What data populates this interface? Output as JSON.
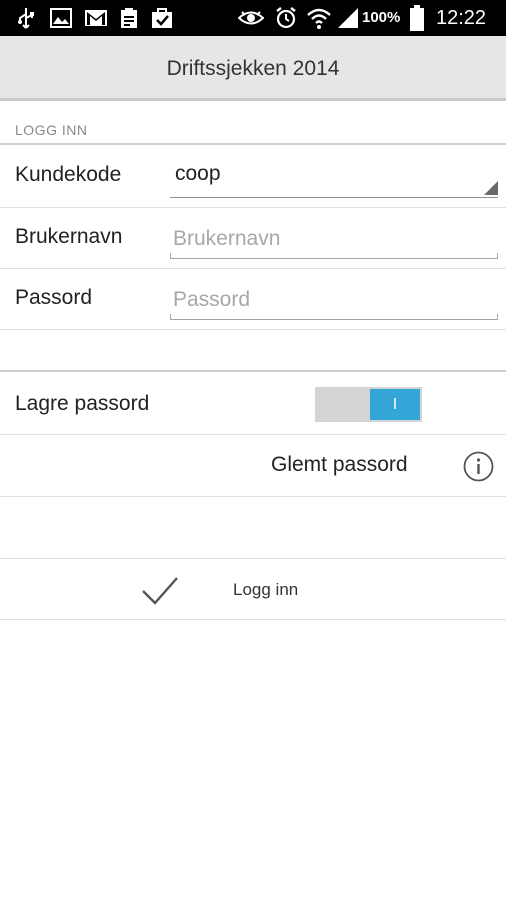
{
  "status_bar": {
    "icons": [
      "usb-icon",
      "image-icon",
      "gmail-icon",
      "clipboard-icon",
      "checkbox-bag-icon",
      "eye-icon",
      "alarm-icon",
      "wifi-icon",
      "signal-icon",
      "battery-icon"
    ],
    "battery_percent": "100%",
    "time": "12:22"
  },
  "action_bar": {
    "title": "Driftssjekken 2014"
  },
  "login": {
    "section_title": "LOGG INN",
    "customer_code": {
      "label": "Kundekode",
      "value": "coop"
    },
    "username": {
      "label": "Brukernavn",
      "placeholder": "Brukernavn",
      "value": ""
    },
    "password": {
      "label": "Passord",
      "placeholder": "Passord",
      "value": ""
    },
    "save_password": {
      "label": "Lagre passord",
      "toggle_text": "I",
      "on": true
    },
    "forgot_password": {
      "label": "Glemt passord"
    },
    "submit": {
      "label": "Logg inn"
    }
  },
  "colors": {
    "accent": "#33a5d6",
    "actionbar": "#e6e6e6",
    "statusbar": "#000000"
  }
}
